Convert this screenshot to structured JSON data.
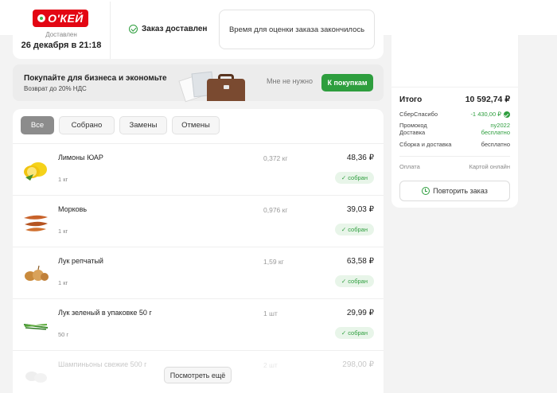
{
  "header": {
    "logo_text": "О'КЕЙ",
    "delivered_label": "Доставлен",
    "delivered_date": "26 декабря в 21:18",
    "status": "Заказ доставлен",
    "rating_text": "Время для оценки заказа закончилось",
    "icons": {
      "logo": "okey-logo",
      "status": "check-circle-icon"
    }
  },
  "business_banner": {
    "title": "Покупайте для бизнеса и экономьте",
    "subtitle": "Возврат до 20% НДС",
    "decline": "Мне не нужно",
    "cta": "К покупкам"
  },
  "tabs": [
    {
      "label": "Все",
      "active": true
    },
    {
      "label": "Собрано",
      "active": false
    },
    {
      "label": "Замены",
      "active": false
    },
    {
      "label": "Отмены",
      "active": false
    }
  ],
  "items": [
    {
      "name": "Лимоны ЮАР",
      "unit": "1 кг",
      "qty": "0,372 кг",
      "price": "48,36 ₽",
      "status": "✓ собран",
      "icon": "lemon-icon"
    },
    {
      "name": "Морковь",
      "unit": "1 кг",
      "qty": "0,976 кг",
      "price": "39,03 ₽",
      "status": "✓ собран",
      "icon": "carrot-icon"
    },
    {
      "name": "Лук репчатый",
      "unit": "1 кг",
      "qty": "1,59 кг",
      "price": "63,58 ₽",
      "status": "✓ собран",
      "icon": "onion-icon"
    },
    {
      "name": "Лук зеленый в упаковке 50 г",
      "unit": "50 г",
      "qty": "1 шт",
      "price": "29,99 ₽",
      "status": "✓ собран",
      "icon": "green-onion-icon"
    },
    {
      "name": "Шампиньоны свежие 500 г",
      "unit": "",
      "qty": "2 шт",
      "price": "298,00 ₽",
      "status": "",
      "icon": "mushroom-icon"
    }
  ],
  "more_button": "Посмотреть ещё",
  "summary": {
    "total_label": "Итого",
    "total_value": "10 592,74 ₽",
    "sber_label": "СберСпасибо",
    "sber_value": "-1 430,00 ₽",
    "promo_label": "Промокод",
    "promo_value": "ny2022",
    "delivery_label": "Доставка",
    "delivery_value": "бесплатно",
    "assembly_label": "Сборка и доставка",
    "assembly_value": "бесплатно",
    "payment_label": "Оплата",
    "payment_value": "Картой онлайн",
    "repeat_button": "Повторить заказ",
    "colors": {
      "accent": "#2e9e3e",
      "brand": "#e30613"
    }
  }
}
